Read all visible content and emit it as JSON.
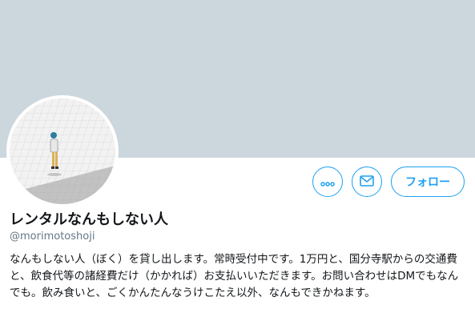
{
  "profile": {
    "name": "レンタルなんもしない人",
    "handle": "@morimotoshoji",
    "bio": "なんもしない人（ぼく）を貸し出します。常時受付中です。1万円と、国分寺駅からの交通費と、飲食代等の諸経費だけ（かかれば）お支払いいただきます。お問い合わせはDMでもなんでも。飲み食いと、ごくかんたんなうけこたえ以外、なんもできかねます。"
  },
  "actions": {
    "more_icon": "more-dots-icon",
    "dm_icon": "envelope-icon",
    "follow_label": "フォロー"
  },
  "colors": {
    "accent": "#1da1f2",
    "banner": "#ccd6dd",
    "secondary_text": "#657786"
  }
}
